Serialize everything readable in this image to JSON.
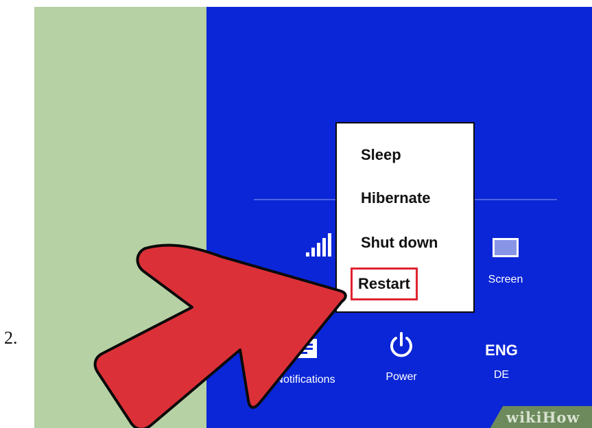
{
  "step": {
    "number": "2."
  },
  "power_menu": {
    "items": [
      {
        "label": "Sleep"
      },
      {
        "label": "Hibernate"
      },
      {
        "label": "Shut down"
      },
      {
        "label": "Restart",
        "highlighted": true
      }
    ]
  },
  "settings": {
    "screen_label": "Screen",
    "notifications_label": "Notifications",
    "power_label": "Power",
    "language_code": "ENG",
    "language_region": "DE"
  },
  "watermark": {
    "text": "wikiHow"
  },
  "colors": {
    "charm_background": "#0b26d6",
    "page_background": "#b6d1a4",
    "highlight": "#e02230",
    "arrow": "#dc3038"
  },
  "icons": [
    "signal-icon",
    "screen-icon",
    "notifications-icon",
    "power-icon",
    "arrow-pointer-icon"
  ]
}
